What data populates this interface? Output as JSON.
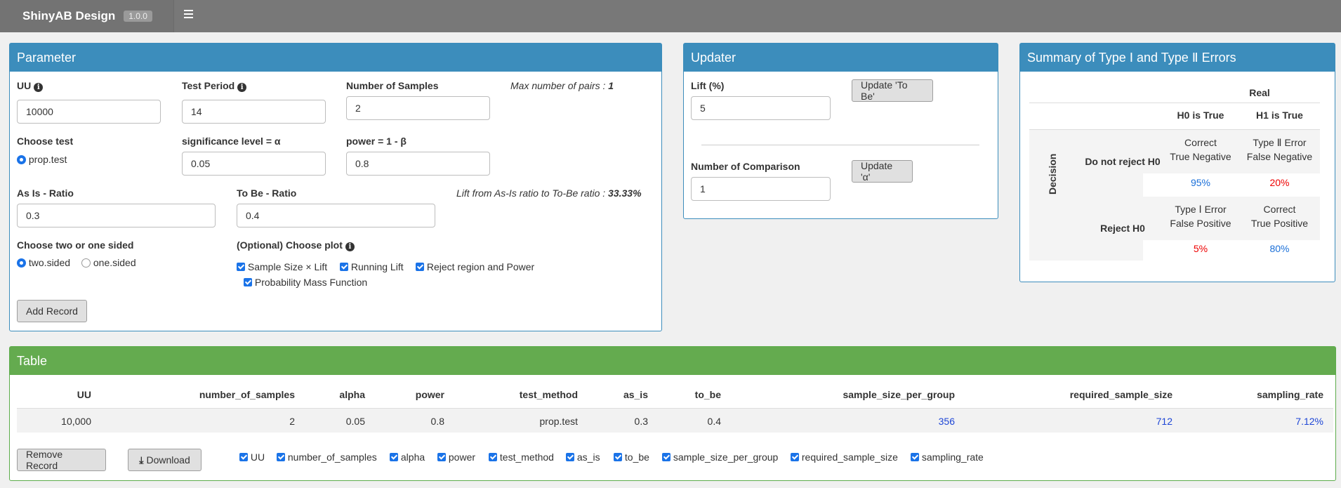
{
  "app": {
    "title": "ShinyAB Design",
    "version": "1.0.0"
  },
  "parameter": {
    "header": "Parameter",
    "uu": {
      "label": "UU",
      "value": "10000"
    },
    "test_period": {
      "label": "Test Period",
      "value": "14"
    },
    "num_samples": {
      "label": "Number of Samples",
      "value": "2"
    },
    "max_pairs": {
      "prefix": "Max number of pairs : ",
      "value": "1"
    },
    "choose_test": {
      "label": "Choose test",
      "option": "prop.test"
    },
    "alpha": {
      "label": "significance level = α",
      "value": "0.05"
    },
    "power": {
      "label": "power = 1 - β",
      "value": "0.8"
    },
    "as_is": {
      "label": "As Is - Ratio",
      "value": "0.3"
    },
    "to_be": {
      "label": "To Be - Ratio",
      "value": "0.4"
    },
    "lift_note": {
      "prefix": "Lift from As-Is ratio to To-Be ratio : ",
      "value": "33.33%"
    },
    "sided": {
      "label": "Choose two or one sided",
      "options": [
        "two.sided",
        "one.sided"
      ],
      "selected": "two.sided"
    },
    "plots": {
      "label": "(Optional) Choose plot",
      "options": [
        "Sample Size × Lift",
        "Running Lift",
        "Reject region and Power",
        "Probability Mass Function"
      ]
    },
    "add_record": "Add Record"
  },
  "updater": {
    "header": "Updater",
    "lift": {
      "label": "Lift (%)",
      "value": "5"
    },
    "update_to_be": "Update 'To Be'",
    "num_comparison": {
      "label": "Number of Comparison",
      "value": "1"
    },
    "update_alpha": "Update 'α'"
  },
  "summary": {
    "header": "Summary of Type Ⅰ  and Type Ⅱ  Errors",
    "real": "Real",
    "h0_true": "H0 is True",
    "h1_true": "H1 is True",
    "decision": "Decision",
    "do_not_reject": "Do not reject H0",
    "reject": "Reject H0",
    "cell_tn": [
      "Correct",
      "True Negative"
    ],
    "cell_fn": [
      "Type Ⅱ  Error",
      "False Negative"
    ],
    "cell_fp": [
      "Type Ⅰ  Error",
      "False Positive"
    ],
    "cell_tp": [
      "Correct",
      "True Positive"
    ],
    "tn_value": "95%",
    "fn_value": "20%",
    "fp_value": "5%",
    "tp_value": "80%"
  },
  "table": {
    "header": "Table",
    "columns": [
      "UU",
      "number_of_samples",
      "alpha",
      "power",
      "test_method",
      "as_is",
      "to_be",
      "sample_size_per_group",
      "required_sample_size",
      "sampling_rate"
    ],
    "rows": [
      [
        "10,000",
        "2",
        "0.05",
        "0.8",
        "prop.test",
        "0.3",
        "0.4",
        "356",
        "712",
        "7.12%"
      ]
    ],
    "remove_record": "Remove Record",
    "download": "Download",
    "column_toggles": [
      "UU",
      "number_of_samples",
      "alpha",
      "power",
      "test_method",
      "as_is",
      "to_be",
      "sample_size_per_group",
      "required_sample_size",
      "sampling_rate"
    ]
  },
  "colors": {
    "box_blue": "#3c8dbc",
    "box_green": "#64ab4f",
    "navbar": "#787878",
    "error_red": "#e00000",
    "value_blue": "#1a6fd8"
  }
}
